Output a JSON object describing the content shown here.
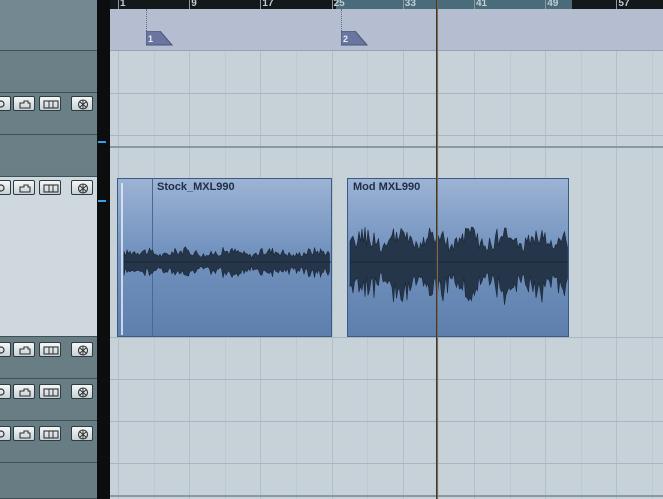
{
  "ruler": {
    "bars": [
      "1",
      "9",
      "17",
      "25",
      "33",
      "41",
      "49",
      "57"
    ],
    "highlight_color": "#4a6c7a"
  },
  "markers": [
    {
      "number": "1"
    },
    {
      "number": "2"
    }
  ],
  "events": [
    {
      "name": "Stock_MXL990"
    },
    {
      "name": "Mod MXL990"
    }
  ],
  "track_buttons": {
    "icons": [
      "lock-icon",
      "folder-lock-icon",
      "lane-icon",
      "freeze-icon"
    ]
  },
  "colors": {
    "event_fill": "#7393bf",
    "event_border": "#3c5a86",
    "marker_flag": "#6b76a0",
    "separator_accent": "#3aa0e8"
  }
}
